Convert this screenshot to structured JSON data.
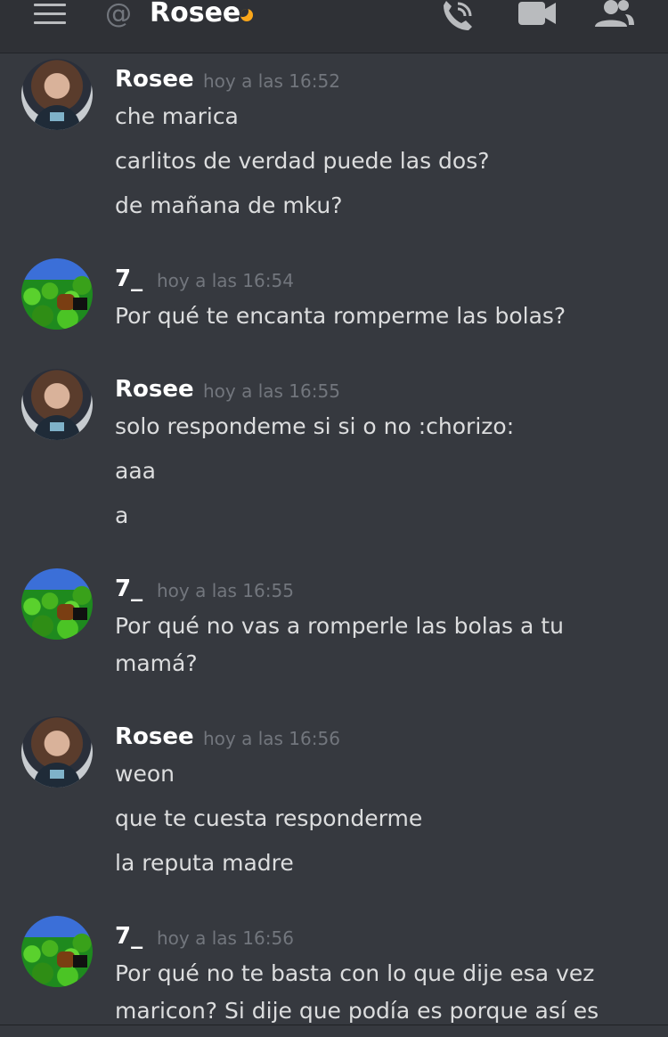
{
  "header": {
    "channel_prefix": "@",
    "channel_name": "Rosee",
    "status": "idle",
    "icons": [
      "menu-icon",
      "at-icon",
      "phone-icon",
      "video-icon",
      "members-icon"
    ]
  },
  "colors": {
    "background": "#36393f",
    "header_bg": "#2f3136",
    "username": "#ffffff",
    "timestamp": "#72767d",
    "text": "#dcddde",
    "idle": "#faa61a"
  },
  "messages": [
    {
      "author": "Rosee",
      "timestamp": "hoy a las 16:52",
      "lines": [
        "che marica",
        "carlitos de verdad puede las dos?",
        "de mañana de mku?"
      ]
    },
    {
      "author": "7_",
      "timestamp": "hoy a las 16:54",
      "lines": [
        "Por qué te encanta romperme las bolas?"
      ]
    },
    {
      "author": "Rosee",
      "timestamp": "hoy a las 16:55",
      "lines": [
        "solo respondeme si si o no :chorizo:",
        "aaa",
        "a"
      ]
    },
    {
      "author": "7_",
      "timestamp": "hoy a las 16:55",
      "lines": [
        "Por qué no vas a romperle las bolas a tu",
        "mamá?"
      ]
    },
    {
      "author": "Rosee",
      "timestamp": "hoy a las 16:56",
      "lines": [
        "weon",
        "que te cuesta responderme",
        "la reputa madre"
      ]
    },
    {
      "author": "7_",
      "timestamp": "hoy a las 16:56",
      "lines": [
        "Por qué no te basta con lo que dije esa vez",
        "maricon? Si dije que podía es porque así es"
      ]
    }
  ]
}
